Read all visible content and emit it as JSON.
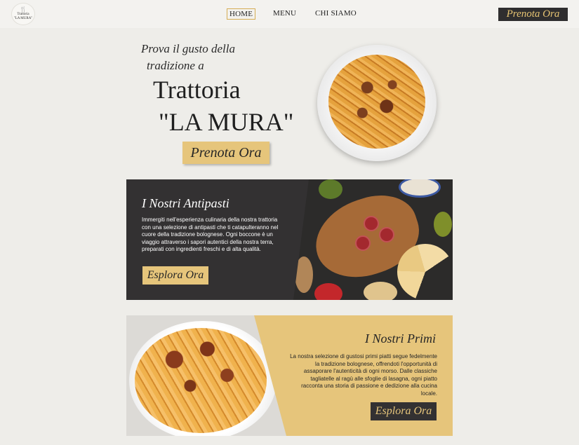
{
  "nav": {
    "logo_line1": "Trattoria",
    "logo_line2": "\"LA MURA\"",
    "home": "HOME",
    "menu": "MENU",
    "about": "CHI SIAMO",
    "cta": "Prenota Ora"
  },
  "hero": {
    "subtitle_line1": "Prova il gusto della",
    "subtitle_line2": "tradizione a",
    "title_line1": "Trattoria",
    "title_line2": "\"LA MURA\"",
    "cta": "Prenota Ora"
  },
  "antipasti": {
    "title": "I Nostri Antipasti",
    "text": "Immergiti nell'esperienza culinaria della nostra trattoria con una selezione di antipasti che ti catapulteranno nel cuore della tradizione bolognese. Ogni boccone è un viaggio attraverso i sapori autentici della nostra terra, preparati con ingredienti freschi e di alta qualità.",
    "cta": "Esplora Ora"
  },
  "primi": {
    "title": "I Nostri Primi",
    "text": "La nostra selezione di gustosi primi piatti segue fedelmente la tradizione bolognese, offrendoti l'opportunità di assaporare l'autenticità di ogni morso. Dalle classiche tagliatelle al ragù alle sfoglie di lasagna, ogni piatto racconta una storia di passione e dedizione alla cucina locale.",
    "cta": "Esplora Ora"
  },
  "colors": {
    "gold": "#e6c57b",
    "dark": "#333132",
    "background": "#eeede9"
  }
}
